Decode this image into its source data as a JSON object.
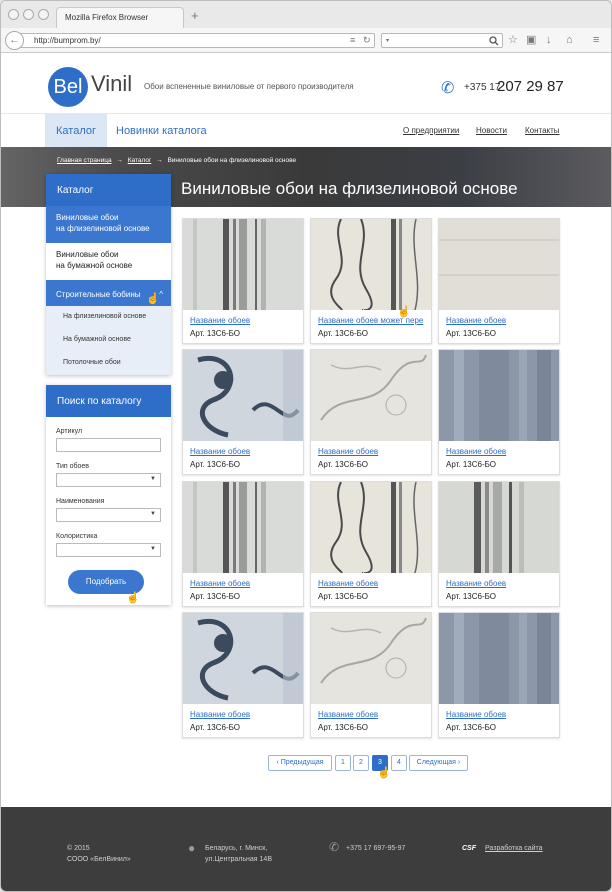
{
  "browser": {
    "tab_title": "Mozilla Firefox Browser",
    "url": "http://bumprom.by/"
  },
  "header": {
    "logo_bel": "Bel",
    "logo_vinil": "Vinil",
    "slogan": "Обои вспененные виниловые от первого производителя",
    "phone_prefix": "+375 17",
    "phone_number": "207 29 87"
  },
  "nav": {
    "catalog": "Каталог",
    "new": "Новинки каталога",
    "about": "О предприятии",
    "news": "Новости",
    "contacts": "Контакты"
  },
  "breadcrumbs": {
    "home": "Главная страница",
    "sep": "→",
    "catalog": "Каталог",
    "current": "Виниловые обои на флизелиновой основе"
  },
  "page_title": "Виниловые обои на флизелиновой основе",
  "sidebar": {
    "title": "Каталог",
    "items": [
      {
        "line1": "Виниловые обои",
        "line2": "на флизелиновой основе"
      },
      {
        "line1": "Виниловые обои",
        "line2": "на бумажной основе"
      }
    ],
    "selected": "Строительные бобины",
    "chevron": "^",
    "subitems": [
      "На флизелиновой основе",
      "На бумажной основе",
      "Потолочные обои"
    ]
  },
  "search": {
    "title": "Поиск по каталогу",
    "article_label": "Артикул",
    "type_label": "Тип обоев",
    "name_label": "Наименования",
    "color_label": "Колористика",
    "button": "Подобрать"
  },
  "products": [
    {
      "name": "Название обоев",
      "art": "Арт. 13С6-БО",
      "pattern": "stripes"
    },
    {
      "name": "Название обоев может пере",
      "art": "Арт. 13С6-БО",
      "pattern": "vines"
    },
    {
      "name": "Название обоев",
      "art": "Арт. 13С6-БО",
      "pattern": "plain"
    },
    {
      "name": "Название обоев",
      "art": "Арт. 13С6-БО",
      "pattern": "damask"
    },
    {
      "name": "Название обоев",
      "art": "Арт. 13С6-БО",
      "pattern": "floral"
    },
    {
      "name": "Название обоев",
      "art": "Арт. 13С6-БО",
      "pattern": "bluestripe"
    },
    {
      "name": "Название обоев",
      "art": "Арт. 13С6-БО",
      "pattern": "stripes"
    },
    {
      "name": "Название обоев",
      "art": "Арт. 13С6-БО",
      "pattern": "vines"
    },
    {
      "name": "Название обоев",
      "art": "Арт. 13С6-БО",
      "pattern": "stripes2"
    },
    {
      "name": "Название обоев",
      "art": "Арт. 13С6-БО",
      "pattern": "damask"
    },
    {
      "name": "Название обоев",
      "art": "Арт. 13С6-БО",
      "pattern": "floral"
    },
    {
      "name": "Название обоев",
      "art": "Арт. 13С6-БО",
      "pattern": "bluestripe"
    }
  ],
  "pagination": {
    "prev": "‹ Предыдущая",
    "pages": [
      "1",
      "2",
      "3",
      "4"
    ],
    "current": "3",
    "next": "Следующая ›"
  },
  "footer": {
    "copyright": "© 2015",
    "company": "СООО «БелВинил»",
    "address1": "Беларусь, г. Минск,",
    "address2": "ул.Центральная 14В",
    "phone": "+375 17 697-95-97",
    "dev_logo": "CSF",
    "dev_link": "Разработка сайта"
  },
  "colors": {
    "accent": "#2f6ec8",
    "footer_bg": "#3d3d3d"
  }
}
